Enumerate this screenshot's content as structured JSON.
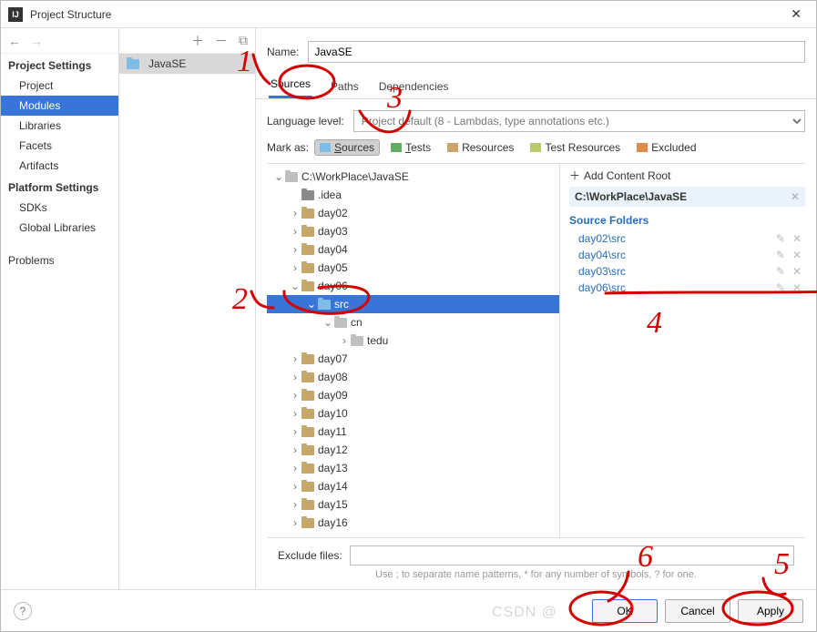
{
  "window": {
    "title": "Project Structure"
  },
  "sidebar": {
    "section1": "Project Settings",
    "items1": [
      "Project",
      "Modules",
      "Libraries",
      "Facets",
      "Artifacts"
    ],
    "section2": "Platform Settings",
    "items2": [
      "SDKs",
      "Global Libraries"
    ],
    "section3": "",
    "items3": [
      "Problems"
    ]
  },
  "module_list": {
    "items": [
      "JavaSE"
    ]
  },
  "main": {
    "name_label": "Name:",
    "name_value": "JavaSE",
    "tabs": [
      "Sources",
      "Paths",
      "Dependencies"
    ],
    "lang_label": "Language level:",
    "lang_value": "Project default (8 - Lambdas, type annotations etc.)",
    "mark_label": "Mark as:",
    "mark_buttons": {
      "sources": "Sources",
      "tests": "Tests",
      "resources": "Resources",
      "test_resources": "Test Resources",
      "excluded": "Excluded"
    },
    "exclude_label": "Exclude files:",
    "exclude_value": "",
    "exclude_hint": "Use ; to separate name patterns, * for any number of symbols, ? for one."
  },
  "tree": [
    {
      "d": 0,
      "t": "open",
      "k": "grey",
      "label": "C:\\WorkPlace\\JavaSE"
    },
    {
      "d": 1,
      "t": "none",
      "k": "dark",
      "label": ".idea"
    },
    {
      "d": 1,
      "t": "closed",
      "k": "fld",
      "label": "day02"
    },
    {
      "d": 1,
      "t": "closed",
      "k": "fld",
      "label": "day03"
    },
    {
      "d": 1,
      "t": "closed",
      "k": "fld",
      "label": "day04"
    },
    {
      "d": 1,
      "t": "closed",
      "k": "fld",
      "label": "day05"
    },
    {
      "d": 1,
      "t": "open",
      "k": "fld",
      "label": "day06"
    },
    {
      "d": 2,
      "t": "open",
      "k": "blue",
      "label": "src",
      "sel": true
    },
    {
      "d": 3,
      "t": "open",
      "k": "grey",
      "label": "cn"
    },
    {
      "d": 4,
      "t": "closed",
      "k": "grey",
      "label": "tedu"
    },
    {
      "d": 1,
      "t": "closed",
      "k": "fld",
      "label": "day07"
    },
    {
      "d": 1,
      "t": "closed",
      "k": "fld",
      "label": "day08"
    },
    {
      "d": 1,
      "t": "closed",
      "k": "fld",
      "label": "day09"
    },
    {
      "d": 1,
      "t": "closed",
      "k": "fld",
      "label": "day10"
    },
    {
      "d": 1,
      "t": "closed",
      "k": "fld",
      "label": "day11"
    },
    {
      "d": 1,
      "t": "closed",
      "k": "fld",
      "label": "day12"
    },
    {
      "d": 1,
      "t": "closed",
      "k": "fld",
      "label": "day13"
    },
    {
      "d": 1,
      "t": "closed",
      "k": "fld",
      "label": "day14"
    },
    {
      "d": 1,
      "t": "closed",
      "k": "fld",
      "label": "day15"
    },
    {
      "d": 1,
      "t": "closed",
      "k": "fld",
      "label": "day16"
    }
  ],
  "roots": {
    "add_label": "Add Content Root",
    "path": "C:\\WorkPlace\\JavaSE",
    "sf_header": "Source Folders",
    "folders": [
      "day02\\src",
      "day04\\src",
      "day03\\src",
      "day06\\src"
    ]
  },
  "footer": {
    "ok": "OK",
    "cancel": "Cancel",
    "apply": "Apply"
  },
  "annotations": [
    "1",
    "2",
    "3",
    "4",
    "5",
    "6"
  ],
  "watermark": "CSDN @"
}
